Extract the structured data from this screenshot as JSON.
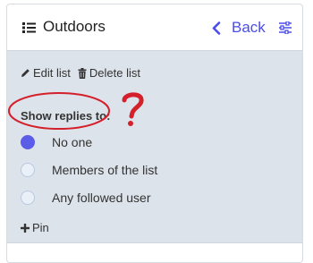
{
  "header": {
    "title": "Outdoors",
    "back_label": "Back",
    "title_icon": "list-icon",
    "back_icon": "chevron-left-icon",
    "settings_icon": "sliders-icon"
  },
  "actions": {
    "edit_label": "Edit list",
    "edit_icon": "pencil-icon",
    "delete_label": "Delete list",
    "delete_icon": "trash-icon"
  },
  "replies": {
    "label": "Show replies to:",
    "options": [
      {
        "label": "No one",
        "selected": true
      },
      {
        "label": "Members of the list",
        "selected": false
      },
      {
        "label": "Any followed user",
        "selected": false
      }
    ]
  },
  "pin": {
    "label": "Pin",
    "icon": "plus-icon"
  },
  "colors": {
    "accent": "#4a4de8",
    "radio_selected": "#5b5ce8",
    "panel_background": "#dde3ea",
    "annotation": "#d4202a"
  }
}
